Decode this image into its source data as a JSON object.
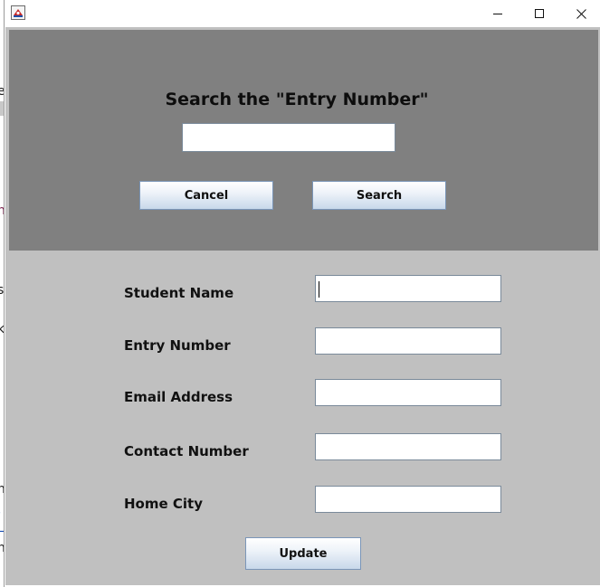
{
  "window": {
    "title": "",
    "app_icon": "java-app-icon",
    "controls": {
      "minimize_icon": "minimize-icon",
      "maximize_icon": "maximize-icon",
      "close_icon": "close-icon"
    }
  },
  "background_fragments": [
    "e",
    "i",
    "n",
    "s",
    "i",
    "k",
    "n",
    ",",
    "L",
    "n"
  ],
  "search_panel": {
    "title": "Search the \"Entry Number\"",
    "search_value": "",
    "cancel_label": "Cancel",
    "search_label": "Search"
  },
  "form": {
    "fields": [
      {
        "label": "Student Name",
        "value": ""
      },
      {
        "label": "Entry Number",
        "value": ""
      },
      {
        "label": "Email Address",
        "value": ""
      },
      {
        "label": "Contact Number",
        "value": ""
      },
      {
        "label": "Home City",
        "value": ""
      }
    ],
    "update_label": "Update"
  },
  "colors": {
    "search_panel_bg": "#808080",
    "form_bg": "#c0c0c0",
    "button_border": "#7b96b8"
  }
}
